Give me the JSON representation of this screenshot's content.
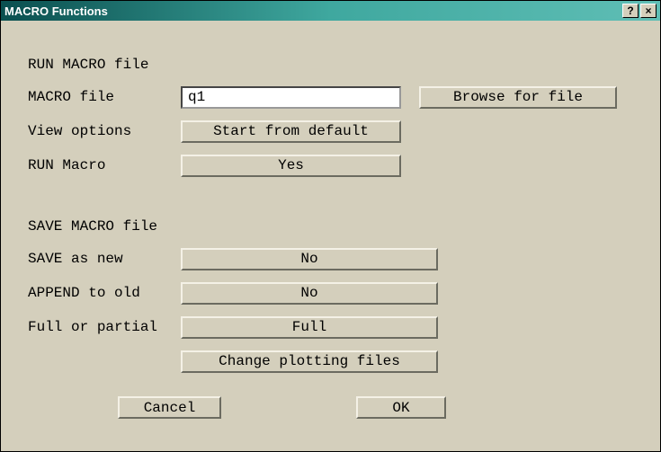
{
  "window": {
    "title": "MACRO Functions"
  },
  "run_section": {
    "title": "RUN MACRO file",
    "macro_file_label": "MACRO file",
    "macro_file_value": "q1",
    "browse_label": "Browse for file",
    "view_options_label": "View options",
    "view_options_btn": "Start from default",
    "run_macro_label": "RUN Macro",
    "run_macro_btn": "Yes"
  },
  "save_section": {
    "title": "SAVE MACRO file",
    "save_as_new_label": "SAVE as new",
    "save_as_new_btn": "No",
    "append_label": "APPEND to old",
    "append_btn": "No",
    "full_partial_label": "Full or partial",
    "full_partial_btn": "Full",
    "change_plot_btn": "Change plotting files"
  },
  "actions": {
    "cancel": "Cancel",
    "ok": "OK"
  }
}
